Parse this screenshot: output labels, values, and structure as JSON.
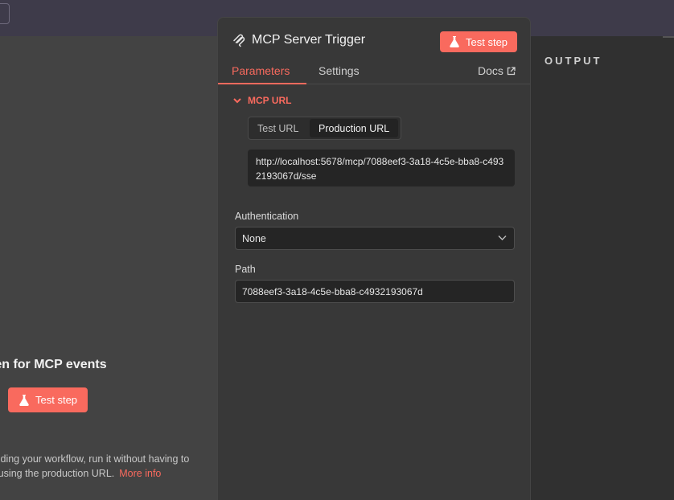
{
  "node": {
    "title": "MCP Server Trigger",
    "test_step_label": "Test step"
  },
  "tabs": {
    "parameters": "Parameters",
    "settings": "Settings",
    "docs": "Docs"
  },
  "mcp_url": {
    "section_label": "MCP URL",
    "toggle_test": "Test URL",
    "toggle_production": "Production URL",
    "selected": "Production URL",
    "url": "http://localhost:5678/mcp/7088eef3-3a18-4c5e-bba8-c4932193067d/sse"
  },
  "authentication": {
    "label": "Authentication",
    "value": "None"
  },
  "path": {
    "label": "Path",
    "value": "7088eef3-3a18-4c5e-bba8-c4932193067d"
  },
  "left_panel": {
    "title": "ten for MCP events",
    "test_step_label": "Test step",
    "desc_line1": "uilding your workflow, run it without having to",
    "desc_line2": "y using the production URL.",
    "more_info": "More info"
  },
  "output": {
    "label": "OUTPUT"
  },
  "colors": {
    "accent": "#f96a5e",
    "panel": "#383838",
    "topbar": "#3e3b4a"
  }
}
